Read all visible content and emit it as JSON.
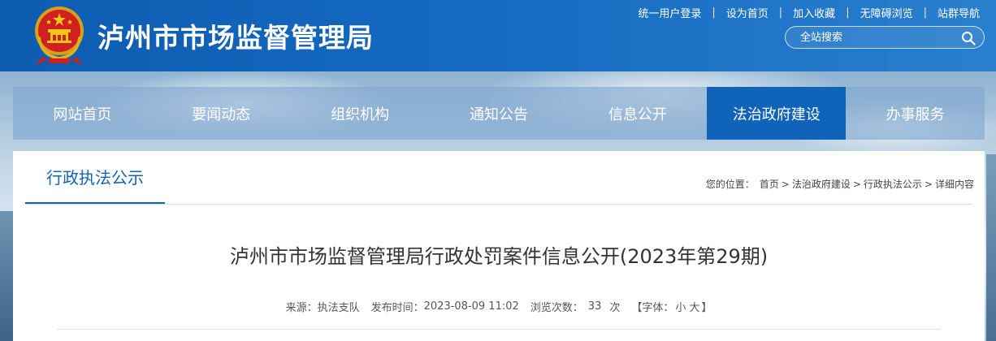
{
  "header": {
    "site_title": "泸州市市场监督管理局",
    "top_links": [
      "统一用户登录",
      "设为首页",
      "加入收藏",
      "无障碍浏览",
      "站群导航"
    ],
    "separator": "|",
    "search_placeholder": "全站搜索"
  },
  "nav": {
    "items": [
      "网站首页",
      "要闻动态",
      "组织机构",
      "通知公告",
      "信息公开",
      "法治政府建设",
      "办事服务"
    ],
    "active_index": 5
  },
  "section": {
    "tab_label": "行政执法公示"
  },
  "breadcrumb": {
    "label": "您的位置：",
    "items": [
      "首页",
      "法治政府建设",
      "行政执法公示",
      "详细内容"
    ],
    "arrow": ">"
  },
  "article": {
    "title": "泸州市市场监督管理局行政处罚案件信息公开(2023年第29期)",
    "source_label": "来源：",
    "source_value": "执法支队",
    "publish_label": "发布时间：",
    "publish_value": "2023-08-09 11:02",
    "views_label": "浏览次数：",
    "views_value": "33",
    "views_unit": "次",
    "font_label": "【字体：",
    "font_small": "小",
    "font_large": "大",
    "font_close": "】"
  },
  "colors": {
    "header_blue": "#0d5cb0",
    "accent_blue": "#0f63b8"
  }
}
